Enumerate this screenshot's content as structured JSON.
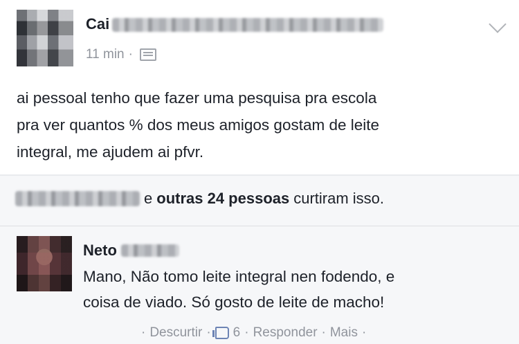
{
  "post": {
    "author": "Cai",
    "time": "11 min",
    "separator": "·",
    "text": "ai pessoal tenho que fazer uma pesquisa pra escola\npra ver quantos % dos meus amigos gostam de leite\nintegral, me ajudem ai pfvr."
  },
  "likes": {
    "connector": "e",
    "others": "outras 24 pessoas",
    "suffix": "curtiram isso."
  },
  "comment": {
    "author": "Neto",
    "text": "Mano, Não tomo leite integral nen fodendo, e\ncoisa de viado. Só gosto de leite de macho!",
    "actions": {
      "sep": "·",
      "unlike": "Descurtir",
      "like_count": "6",
      "reply": "Responder",
      "more": "Mais"
    }
  },
  "icons": {
    "audience": "audience-icon",
    "options": "chevron-down-icon",
    "like": "thumbs-up-icon"
  },
  "colors": {
    "text": "#1d2129",
    "meta": "#90949c",
    "like_blue": "#6d84b4",
    "bg": "#e9ebee"
  }
}
